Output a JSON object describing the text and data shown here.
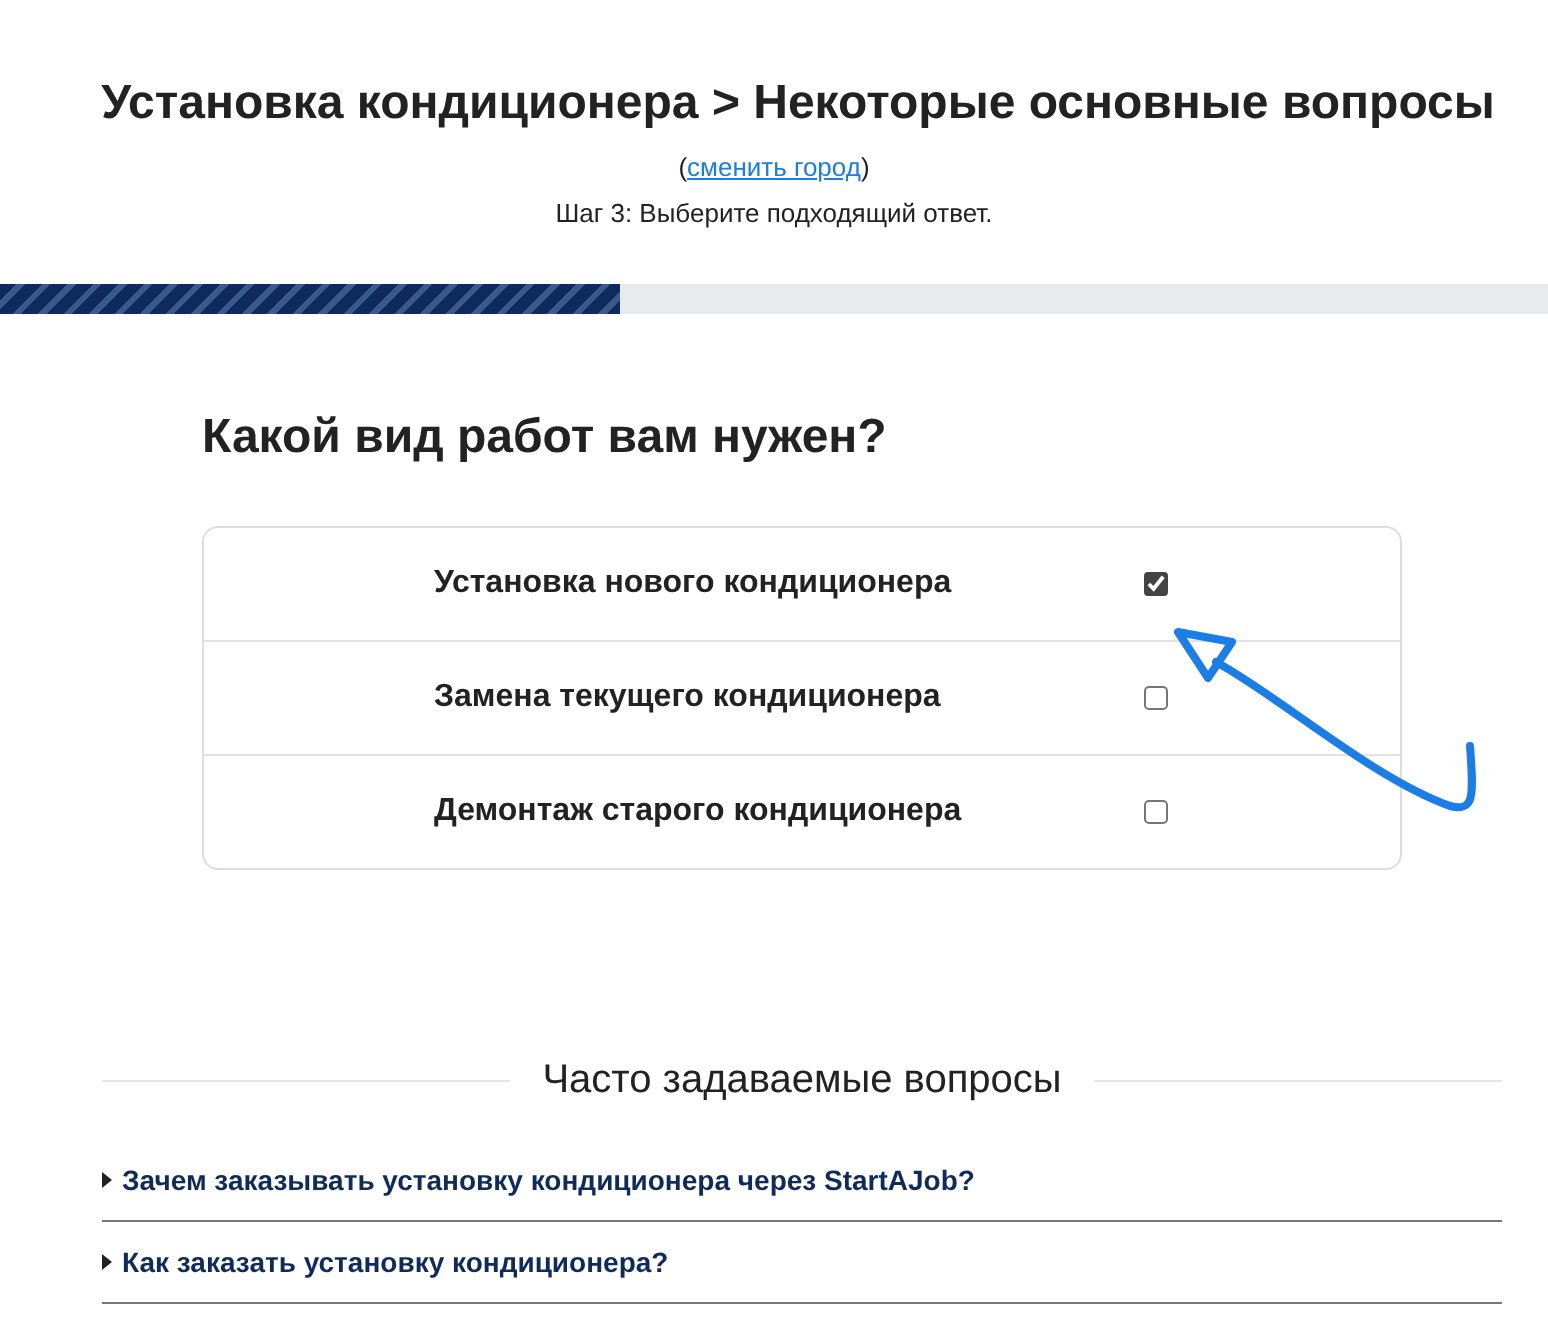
{
  "header": {
    "title": "Установка кондиционера > Некоторые основные вопросы",
    "link_prefix": "(",
    "link": "сменить город",
    "link_suffix": ")",
    "step": "Шаг 3: Выберите подходящий ответ."
  },
  "progress": {
    "level": 0.4
  },
  "question": {
    "title": "Какой вид работ вам нужен?",
    "options": [
      {
        "label": "Установка нового кондиционера",
        "checked": true
      },
      {
        "label": "Замена текущего кондиционера",
        "checked": false
      },
      {
        "label": "Демонтаж старого кондиционера",
        "checked": false
      }
    ]
  },
  "faq": {
    "title": "Часто задаваемые вопросы",
    "items": [
      {
        "question": "Зачем заказывать установку кондиционера через StartAJob?",
        "expanded": false
      },
      {
        "question": "Как заказать установку кондиционера?",
        "expanded": false
      }
    ]
  }
}
